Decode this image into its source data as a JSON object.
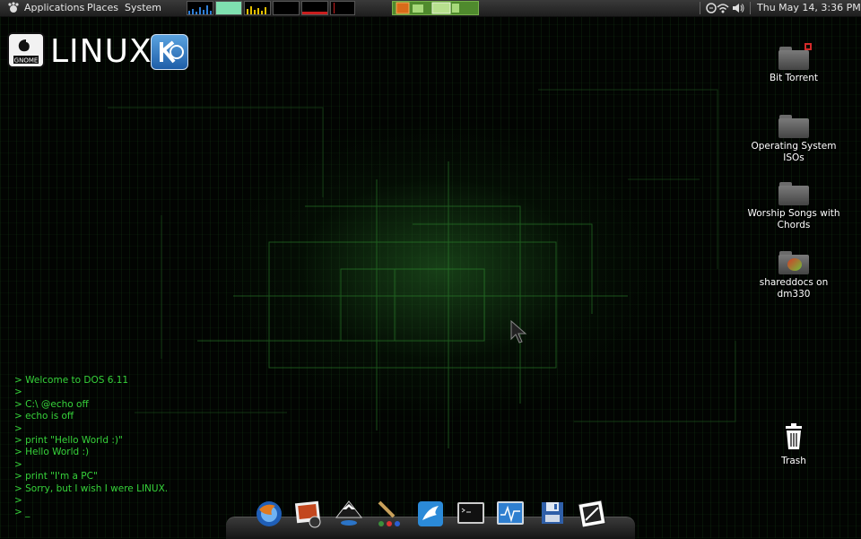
{
  "top_panel": {
    "menus": [
      "Applications",
      "Places",
      "System"
    ],
    "clock": "Thu May 14,  3:36 PM"
  },
  "logo": {
    "text": "LINUX",
    "gnome_label": "GNOME"
  },
  "desktop_icons": [
    {
      "label": "Bit Torrent",
      "icon": "folder-icon"
    },
    {
      "label": "Operating System ISOs",
      "icon": "folder-icon"
    },
    {
      "label": "Worship Songs with Chords",
      "icon": "folder-icon"
    },
    {
      "label": "shareddocs on dm330",
      "icon": "network-share-icon"
    },
    {
      "label": "Trash",
      "icon": "trash-icon"
    }
  ],
  "terminal_lines": [
    "> Welcome to DOS 6.11",
    ">",
    "> C:\\ @echo off",
    "> echo is off",
    ">",
    "> print \"Hello World :)\"",
    "> Hello World :)",
    ">",
    "> print \"I'm a PC\"",
    "> Sorry, but I wish I were LINUX.",
    ">",
    "> _"
  ],
  "dock_items": [
    "browser-icon",
    "photo-viewer-icon",
    "inkscape-icon",
    "paint-icon",
    "wing-app-icon",
    "terminal-icon",
    "system-monitor-icon",
    "disk-utility-icon",
    "picture-editor-icon"
  ],
  "colors": {
    "terminal_green": "#36d33a",
    "panel_bg": "#2a2a2a"
  }
}
